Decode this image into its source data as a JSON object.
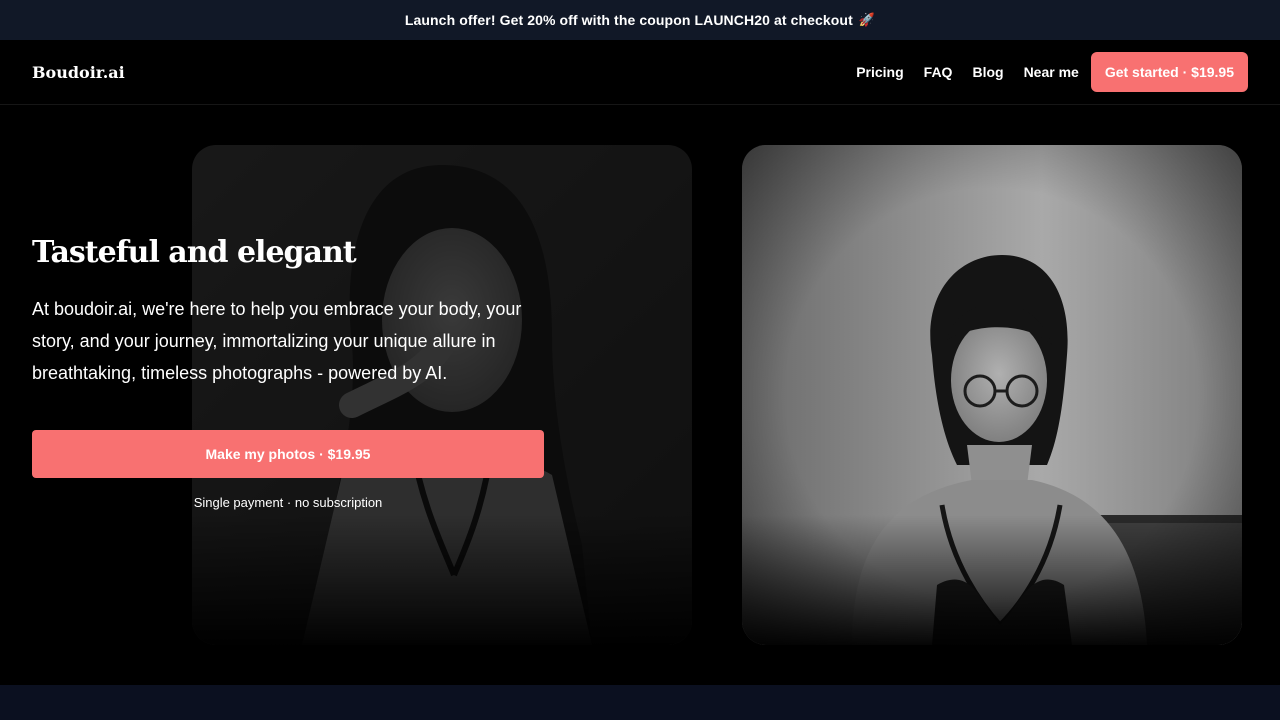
{
  "promo": {
    "text": "Launch offer! Get 20% off with the coupon LAUNCH20 at checkout",
    "icon": "rocket-icon",
    "glyph": "🚀"
  },
  "nav": {
    "logo": "Boudoir.ai",
    "links": [
      "Pricing",
      "FAQ",
      "Blog",
      "Near me"
    ],
    "cta": "Get started · $19.95"
  },
  "hero": {
    "title": "Tasteful and elegant",
    "description": "At boudoir.ai, we're here to help you embrace your body, your story, and your journey, immortalizing your unique allure in breathtaking, timeless photographs - powered by AI.",
    "cta": "Make my photos · $19.95",
    "note": "Single payment · no subscription"
  },
  "colors": {
    "accent": "#f87171",
    "promo_bg": "#111827",
    "page_bg": "#000000"
  }
}
